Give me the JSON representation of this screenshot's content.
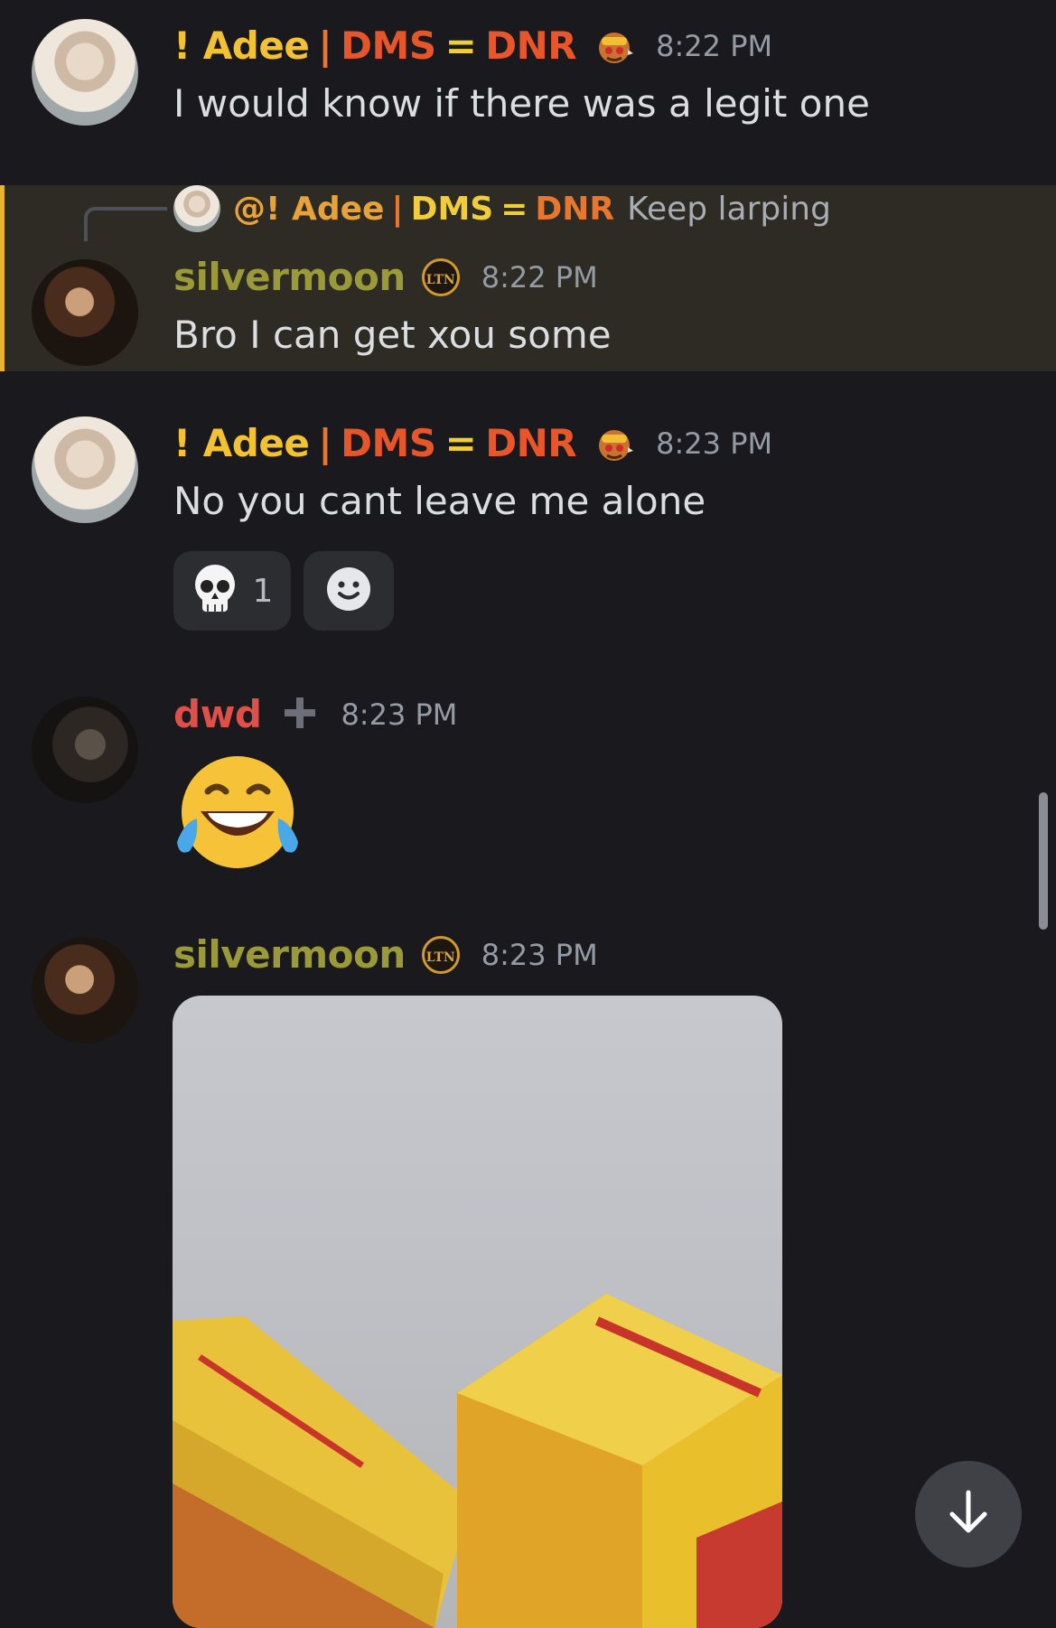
{
  "messages": [
    {
      "author": {
        "part1": "! Adee",
        "sep": "|",
        "part2": "DMS",
        "eq": "=",
        "part3": "DNR"
      },
      "time": "8:22 PM",
      "text": "I would know if there was a legit one"
    },
    {
      "reply_to": {
        "mention": "@! Adee",
        "sep": "|",
        "part2": "DMS",
        "eq": "=",
        "part3": "DNR",
        "snippet": "Keep larping"
      },
      "author": "silvermoon",
      "badge": "LTN",
      "time": "8:22 PM",
      "text": "Bro I can get xou some",
      "highlighted": true
    },
    {
      "author": {
        "part1": "! Adee",
        "sep": "|",
        "part2": "DMS",
        "eq": "=",
        "part3": "DNR"
      },
      "time": "8:23 PM",
      "text": "No you cant leave me alone",
      "reactions": [
        {
          "emoji": "skull-emoji",
          "count": "1"
        }
      ]
    },
    {
      "author": "dwd",
      "time": "8:23 PM",
      "emoji": "face-with-tears-of-joy"
    },
    {
      "author": "silvermoon",
      "badge": "LTN",
      "time": "8:23 PM",
      "attachment": "photo"
    }
  ],
  "colors": {
    "background": "#1a1a1e",
    "highlight": "#2e2a24",
    "highlight_bar": "#e8b330",
    "timestamp": "#949ba4"
  }
}
